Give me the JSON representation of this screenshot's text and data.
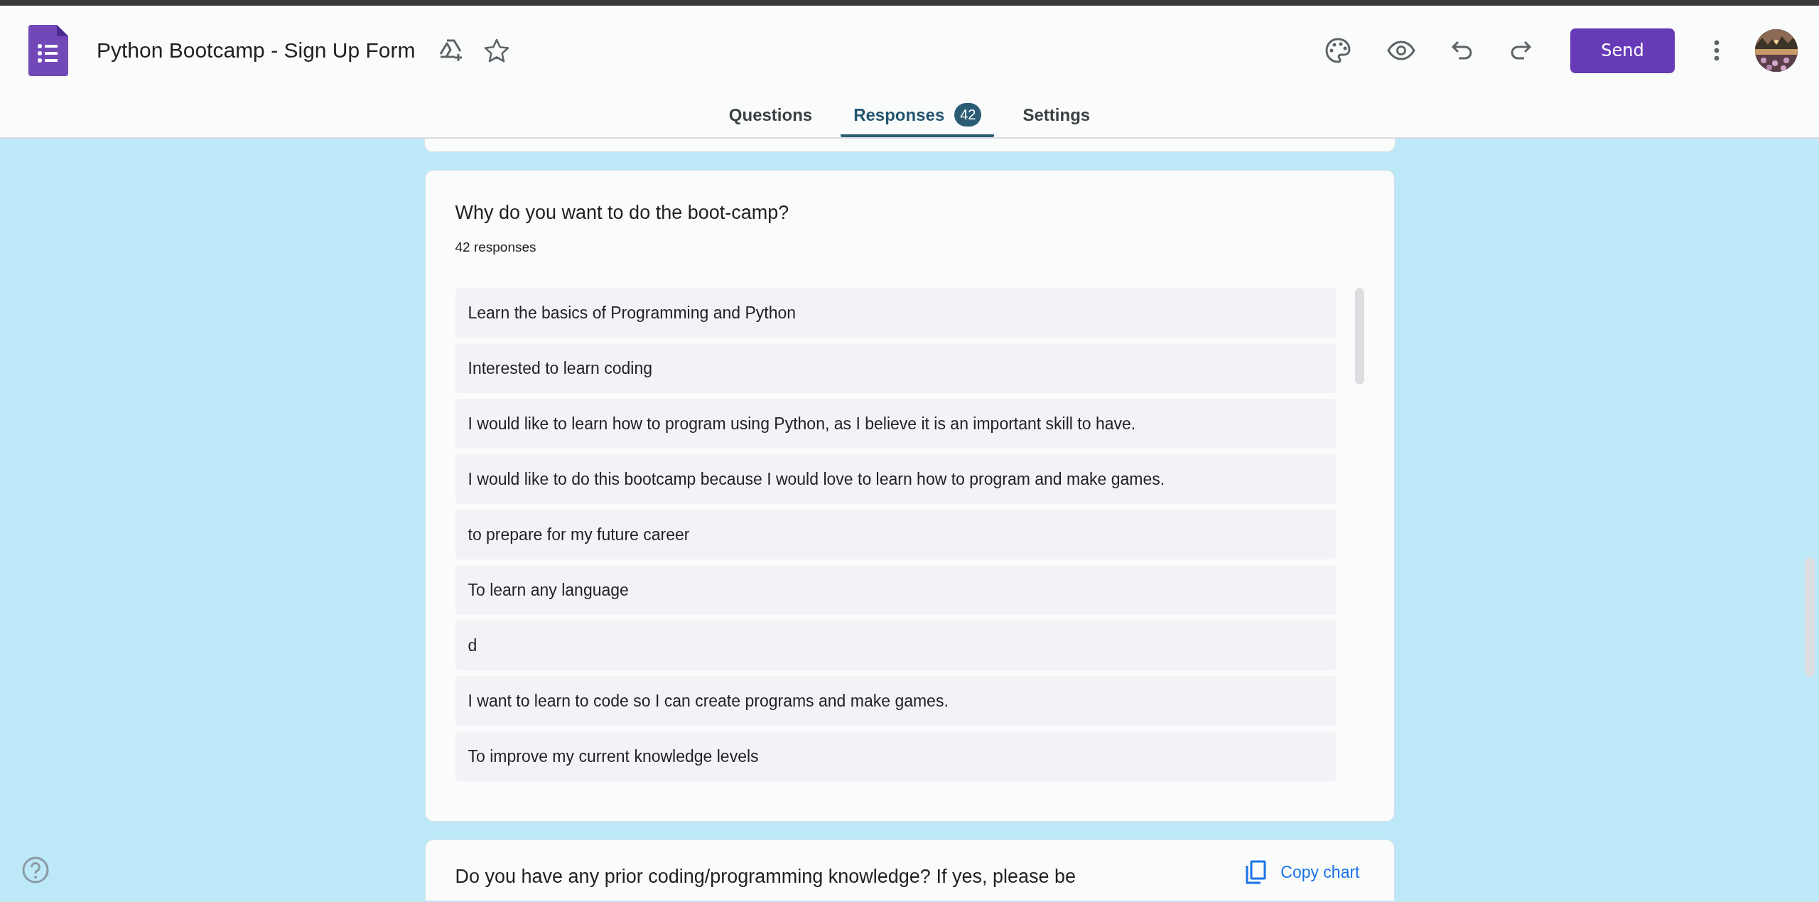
{
  "app": {
    "title": "Python Bootcamp - Sign Up Form",
    "send_label": "Send"
  },
  "tabs": [
    {
      "label": "Questions",
      "selected": false
    },
    {
      "label": "Responses",
      "selected": true,
      "badge": "42"
    },
    {
      "label": "Settings",
      "selected": false
    }
  ],
  "question_card": {
    "title": "Why do you want to do the boot-camp?",
    "count": "42 responses",
    "responses": [
      "Learn the basics of Programming and Python",
      "Interested to learn coding",
      "I would like to learn how to program using Python, as I believe it is an important skill to have.",
      "I would like to do this bootcamp because I would love to learn how to program and make games.",
      "to prepare for my future career",
      "To learn any language",
      "d",
      "I want to learn to code so I can create programs and make games.",
      "To improve my current knowledge levels"
    ]
  },
  "next_card": {
    "title": "Do you have any prior coding/programming knowledge? If yes, please be",
    "action": "Copy chart"
  }
}
